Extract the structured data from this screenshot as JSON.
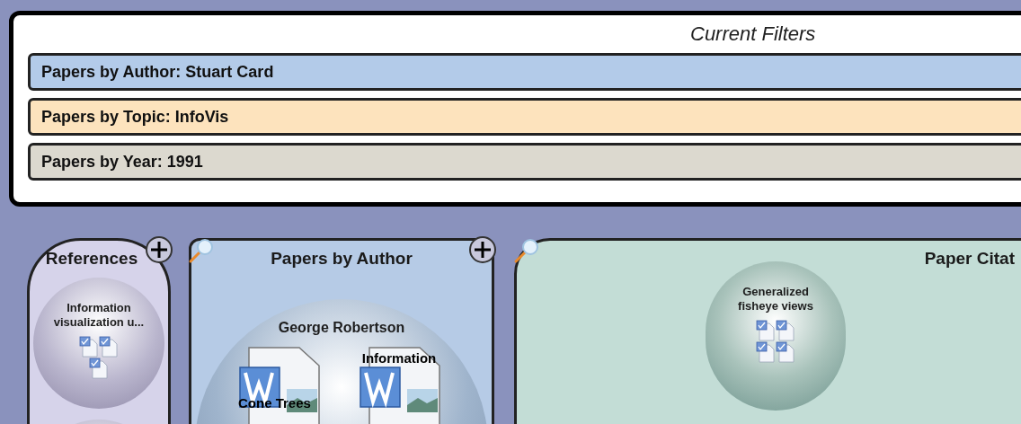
{
  "filters": {
    "title": "Current Filters",
    "items": [
      {
        "label": "Papers by Author: Stuart Card",
        "color": "#b3cbe9"
      },
      {
        "label": "Papers by Topic: InfoVis",
        "color": "#fde3bd"
      },
      {
        "label": "Papers by Year: 1991",
        "color": "#dcd9cf"
      }
    ]
  },
  "panels": [
    {
      "kind": "narrow",
      "title": "References",
      "color": "#d6d3ea",
      "search": false,
      "add": true,
      "bubbles": [
        {
          "kind": "docs",
          "title": "Information visualization u...",
          "docs": [
            {
              "kind": "page"
            },
            {
              "kind": "page"
            },
            {
              "kind": "page"
            }
          ]
        },
        {
          "kind": "empty"
        }
      ]
    },
    {
      "kind": "card",
      "title": "Papers by Author",
      "color": "#b6cbe6",
      "search": true,
      "add": true,
      "bubbles": [
        {
          "kind": "word",
          "title": "George Robertson",
          "items": [
            {
              "label": "Cone Trees"
            },
            {
              "label": "Information"
            }
          ]
        }
      ]
    },
    {
      "kind": "wide",
      "title": "Paper Citat",
      "color": "#c3ddd6",
      "search": true,
      "add": false,
      "bubbles": [
        {
          "kind": "docs",
          "title": "Generalized fisheye views",
          "docs": [
            {
              "kind": "page"
            },
            {
              "kind": "page"
            },
            {
              "kind": "page"
            },
            {
              "kind": "page"
            }
          ]
        }
      ]
    }
  ]
}
